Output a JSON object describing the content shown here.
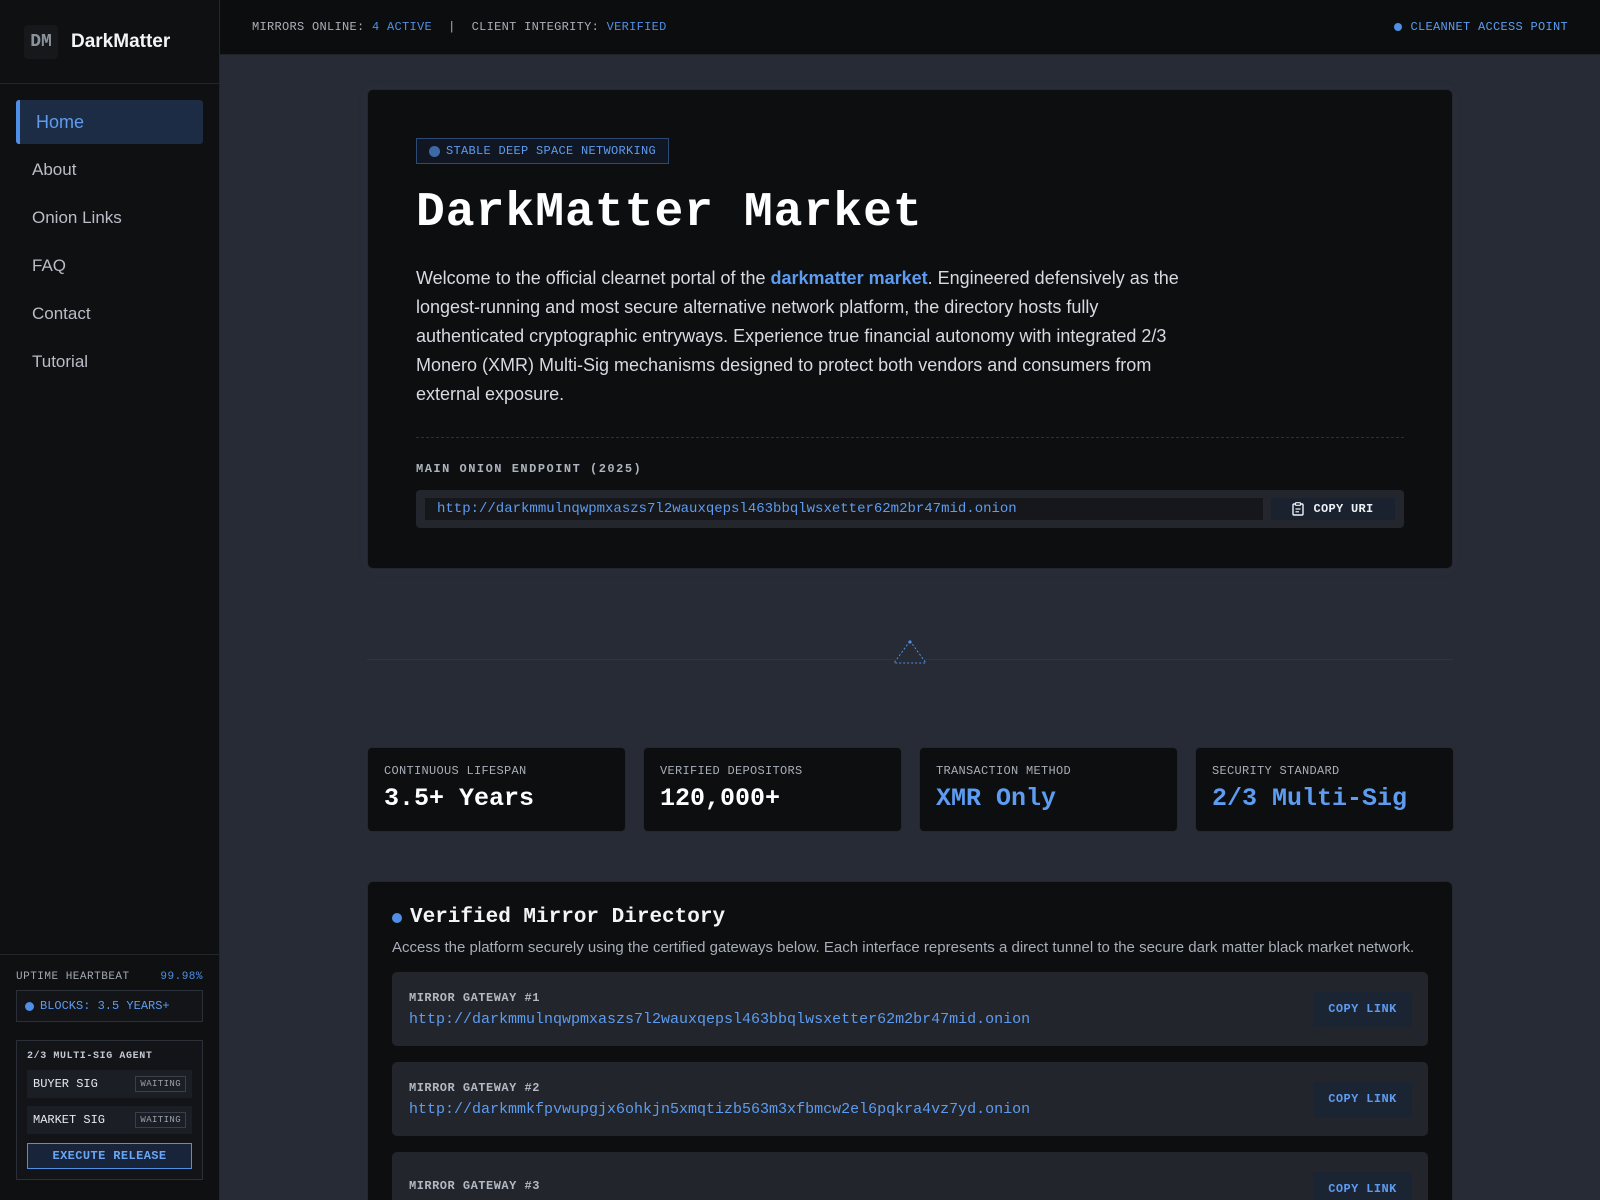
{
  "brand": {
    "logo": "DM",
    "name": "DarkMatter"
  },
  "nav": [
    {
      "label": "Home",
      "active": true
    },
    {
      "label": "About"
    },
    {
      "label": "Onion Links"
    },
    {
      "label": "FAQ"
    },
    {
      "label": "Contact"
    },
    {
      "label": "Tutorial"
    }
  ],
  "sidebar_bottom": {
    "heartbeat_label": "UPTIME HEARTBEAT",
    "heartbeat_value": "99.98%",
    "blocks": "BLOCKS: 3.5 YEARS+",
    "agent_title": "2/3 MULTI-SIG AGENT",
    "buyer_sig": "BUYER SIG",
    "market_sig": "MARKET SIG",
    "waiting": "WAITING",
    "execute": "EXECUTE RELEASE"
  },
  "topbar": {
    "mirrors_label": "MIRRORS ONLINE:",
    "mirrors_value": "4 ACTIVE",
    "separator": "|",
    "integrity_label": "CLIENT INTEGRITY:",
    "integrity_value": "VERIFIED",
    "access_point": "CLEANNET ACCESS POINT"
  },
  "hero": {
    "tag": "STABLE DEEP SPACE NETWORKING",
    "title": "DarkMatter Market",
    "text_before": "Welcome to the official clearnet portal of the ",
    "text_link": "darkmatter market",
    "text_after": ". Engineered defensively as the longest-running and most secure alternative network platform, the directory hosts fully authenticated cryptographic entryways. Experience true financial autonomy with integrated 2/3 Monero (XMR) Multi-Sig mechanisms designed to protect both vendors and consumers from external exposure.",
    "endpoint_label": "MAIN ONION ENDPOINT (2025)",
    "endpoint_url": "http://darkmmulnqwpmxaszs7l2wauxqepsl463bbqlwsxetter62m2br47mid.onion",
    "copy_uri": "COPY URI"
  },
  "stats": [
    {
      "label": "CONTINUOUS LIFESPAN",
      "value": "3.5+ Years",
      "blue": false
    },
    {
      "label": "VERIFIED DEPOSITORS",
      "value": "120,000+",
      "blue": false
    },
    {
      "label": "TRANSACTION METHOD",
      "value": "XMR Only",
      "blue": true
    },
    {
      "label": "SECURITY STANDARD",
      "value": "2/3 Multi-Sig",
      "blue": true
    }
  ],
  "mirror": {
    "title": "Verified Mirror Directory",
    "desc": "Access the platform securely using the certified gateways below. Each interface represents a direct tunnel to the secure dark matter black market network.",
    "copy_link": "COPY LINK",
    "gateways": [
      {
        "label": "MIRROR GATEWAY #1",
        "url": "http://darkmmulnqwpmxaszs7l2wauxqepsl463bbqlwsxetter62m2br47mid.onion"
      },
      {
        "label": "MIRROR GATEWAY #2",
        "url": "http://darkmmkfpvwupgjx6ohkjn5xmqtizb563m3xfbmcw2el6pqkra4vz7yd.onion"
      },
      {
        "label": "MIRROR GATEWAY #3",
        "url": ""
      }
    ]
  },
  "colors": {
    "accent": "#4f8fe6",
    "background": "#272b35",
    "card": "#0d0e10"
  }
}
